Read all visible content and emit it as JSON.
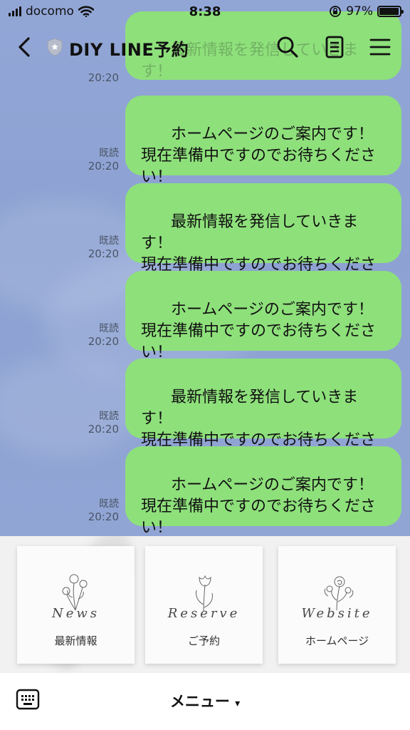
{
  "status_bar": {
    "carrier": "docomo",
    "time": "8:38",
    "battery_percent": "97%",
    "battery_level": 0.97
  },
  "header": {
    "title": "DIY LINE予約",
    "back_icon": "chevron-left-icon",
    "search_icon": "search-icon",
    "notes_icon": "note-icon",
    "menu_icon": "hamburger-icon"
  },
  "messages": [
    {
      "text": "最新情報を発信していきます！\n現在準備中ですのでお待ちください！",
      "read": "",
      "time": "20:20"
    },
    {
      "text": "ホームページのご案内です！\n現在準備中ですのでお待ちください！",
      "read": "既読",
      "time": "20:20"
    },
    {
      "text": "最新情報を発信していきます！\n現在準備中ですのでお待ちください！",
      "read": "既読",
      "time": "20:20"
    },
    {
      "text": "ホームページのご案内です！\n現在準備中ですのでお待ちください！",
      "read": "既読",
      "time": "20:20"
    },
    {
      "text": "最新情報を発信していきます！\n現在準備中ですのでお待ちください！",
      "read": "既読",
      "time": "20:20"
    },
    {
      "text": "ホームページのご案内です！\n現在準備中ですのでお待ちください！",
      "read": "既読",
      "time": "20:20"
    }
  ],
  "rich_menu": {
    "items": [
      {
        "script": "News",
        "label": "最新情報",
        "icon": "flower-bouquet-icon"
      },
      {
        "script": "Reserve",
        "label": "ご予約",
        "icon": "tulip-icon"
      },
      {
        "script": "Website",
        "label": "ホームページ",
        "icon": "rose-branch-icon"
      }
    ]
  },
  "bottom_bar": {
    "keyboard_icon": "keyboard-icon",
    "menu_label": "メニュー",
    "menu_arrow": "▾"
  },
  "colors": {
    "chat_background": "#8fa3d4",
    "bubble": "#8ee07b",
    "rich_menu_background": "#f1f1f1"
  }
}
